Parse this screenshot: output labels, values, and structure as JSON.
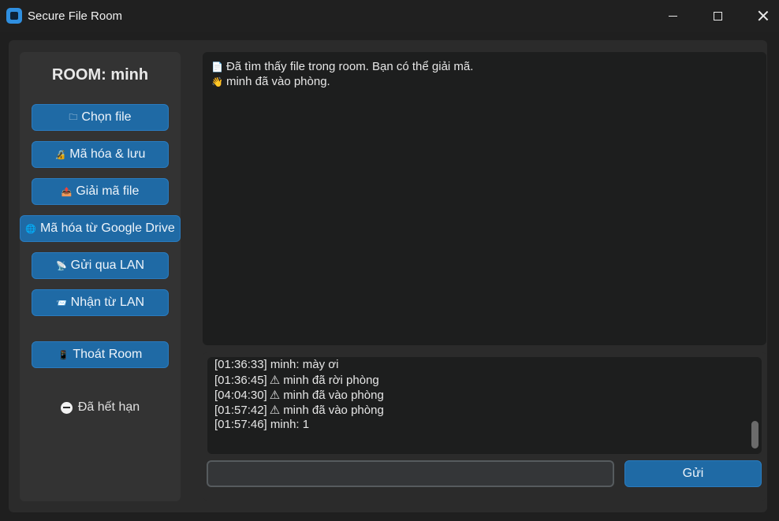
{
  "window": {
    "title": "Secure File Room",
    "accent_color": "#1f6aa5"
  },
  "sidebar": {
    "room_title": "ROOM: minh",
    "buttons": [
      {
        "icon": "folder-icon",
        "glyph": "🗀",
        "label": "Chọn file"
      },
      {
        "icon": "lock-icon",
        "glyph": "🔏",
        "label": "Mã hóa & lưu"
      },
      {
        "icon": "unlock-icon",
        "glyph": "📤",
        "label": "Giải mã file"
      },
      {
        "icon": "globe-icon",
        "glyph": "🌐",
        "label": "Mã hóa từ Google Drive"
      },
      {
        "icon": "satellite-icon",
        "glyph": "📡",
        "label": "Gửi qua LAN"
      },
      {
        "icon": "inbox-icon",
        "glyph": "📨",
        "label": "Nhận từ LAN"
      }
    ],
    "exit_button": {
      "icon": "phone-icon",
      "glyph": "📱",
      "label": "Thoát Room"
    },
    "status": {
      "icon": "no-entry-icon",
      "label": "Đã hết hạn"
    }
  },
  "notifications": [
    {
      "icon": "document-icon",
      "glyph": "📄",
      "text": "Đã tìm thấy file trong room. Bạn có thể giải mã."
    },
    {
      "icon": "wave-hand-icon",
      "glyph": "👋",
      "text": "minh đã vào phòng."
    }
  ],
  "chat": {
    "partial_top_line": "[01:36:33] minh: mày ơi",
    "messages": [
      {
        "time": "[01:36:45]",
        "warning": true,
        "text": "minh đã rời phòng"
      },
      {
        "time": "[04:04:30]",
        "warning": true,
        "text": "minh đã vào phòng"
      },
      {
        "time": "[01:57:42]",
        "warning": true,
        "text": "minh đã vào phòng"
      },
      {
        "time": "[01:57:46]",
        "warning": false,
        "text": "minh: 1"
      }
    ],
    "input_value": "",
    "send_label": "Gửi"
  }
}
